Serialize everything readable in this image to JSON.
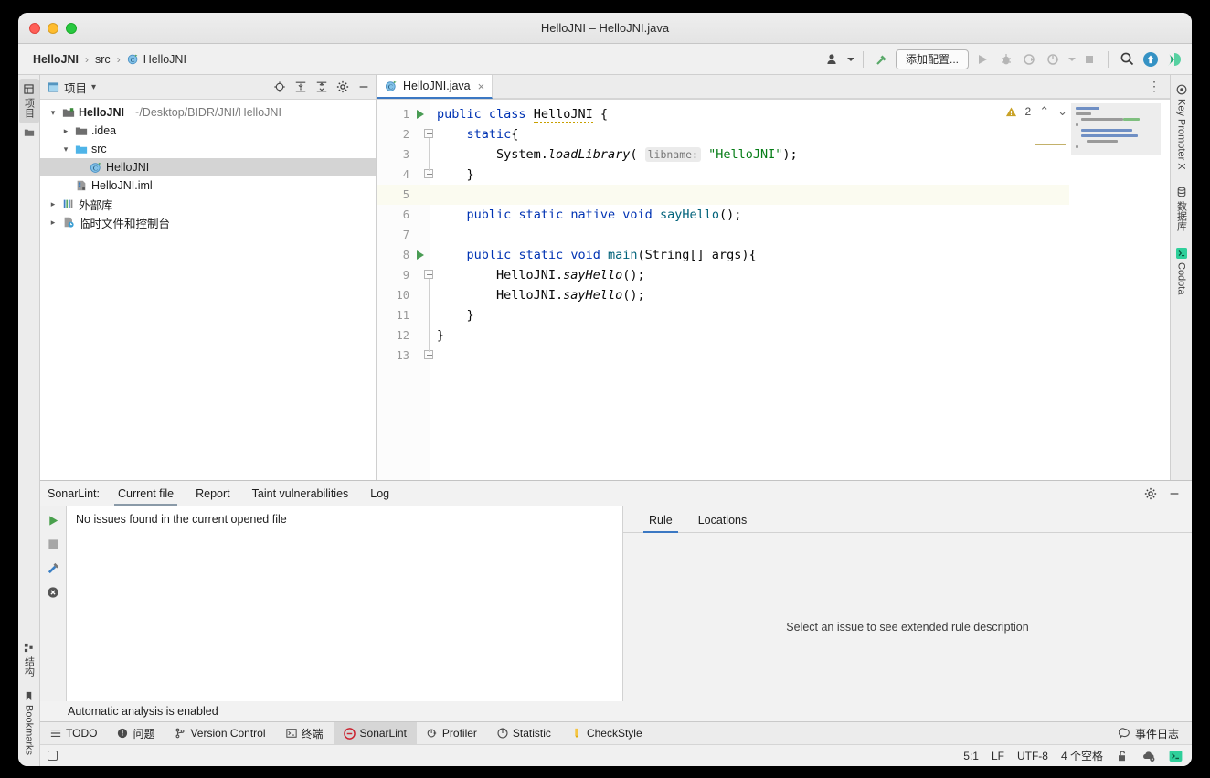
{
  "window": {
    "title": "HelloJNI – HelloJNI.java",
    "traffic": [
      "close",
      "minimize",
      "zoom"
    ]
  },
  "navbar": {
    "breadcrumb": [
      {
        "label": "HelloJNI",
        "icon": "none",
        "bold": true
      },
      {
        "label": "src",
        "icon": "none",
        "bold": false
      },
      {
        "label": "HelloJNI",
        "icon": "java-class-icon",
        "bold": false
      }
    ],
    "separator": "›",
    "config_button": "添加配置...",
    "actions": [
      {
        "name": "user-profile",
        "icon": "person-icon"
      },
      {
        "name": "build-hammer",
        "icon": "hammer-icon"
      },
      {
        "name": "run",
        "icon": "play-icon"
      },
      {
        "name": "debug",
        "icon": "bug-icon"
      },
      {
        "name": "run-with-coverage",
        "icon": "coverage-icon"
      },
      {
        "name": "profile",
        "icon": "profiler-icon"
      },
      {
        "name": "stop",
        "icon": "stop-icon"
      },
      {
        "name": "search-everywhere",
        "icon": "search-icon"
      },
      {
        "name": "update-project",
        "icon": "update-icon"
      },
      {
        "name": "codota",
        "icon": "codota-icon"
      }
    ]
  },
  "left_strip": {
    "top": [
      {
        "label": "项目",
        "icon": "project-icon",
        "active": true
      }
    ],
    "bottom": [
      {
        "label": "结构",
        "icon": "structure-icon",
        "active": false
      },
      {
        "label": "Bookmarks",
        "icon": "bookmark-icon",
        "active": false
      }
    ]
  },
  "right_strip": {
    "items": [
      {
        "label": "Key Promoter X",
        "icon": "key-promoter-icon"
      },
      {
        "label": "数据库",
        "icon": "database-icon"
      },
      {
        "label": "Codota",
        "icon": "codota-icon"
      }
    ]
  },
  "project_panel": {
    "title": "项目",
    "dropdown_caret": "▾",
    "actions": [
      {
        "name": "select-opened-file",
        "icon": "locate-icon"
      },
      {
        "name": "expand-all",
        "icon": "expand-all-icon"
      },
      {
        "name": "collapse-all",
        "icon": "collapse-all-icon"
      },
      {
        "name": "settings",
        "icon": "gear-icon"
      },
      {
        "name": "hide",
        "icon": "minimize-icon"
      }
    ],
    "tree": [
      {
        "label": "HelloJNI",
        "path": "~/Desktop/BIDR/JNI/HelloJNI",
        "icon": "module-icon",
        "arrow": "expanded",
        "depth": 0,
        "bold": true,
        "selected": false
      },
      {
        "label": ".idea",
        "path": "",
        "icon": "folder-icon",
        "arrow": "collapsed",
        "depth": 1,
        "bold": false,
        "selected": false
      },
      {
        "label": "src",
        "path": "",
        "icon": "source-folder-icon",
        "arrow": "expanded",
        "depth": 1,
        "bold": false,
        "selected": false
      },
      {
        "label": "HelloJNI",
        "path": "",
        "icon": "java-class-icon",
        "arrow": "none",
        "depth": 2,
        "bold": false,
        "selected": true
      },
      {
        "label": "HelloJNI.iml",
        "path": "",
        "icon": "iml-file-icon",
        "arrow": "none",
        "depth": 1,
        "bold": false,
        "selected": false
      },
      {
        "label": "外部库",
        "path": "",
        "icon": "library-icon",
        "arrow": "collapsed",
        "depth": 0,
        "bold": false,
        "selected": false
      },
      {
        "label": "临时文件和控制台",
        "path": "",
        "icon": "scratches-icon",
        "arrow": "collapsed",
        "depth": 0,
        "bold": false,
        "selected": false
      }
    ]
  },
  "editor": {
    "tab": {
      "label": "HelloJNI.java",
      "icon": "java-class-icon",
      "close": "×"
    },
    "more_icon": "⋮",
    "inspections": {
      "icon": "warning-triangle-icon",
      "count": "2",
      "prev": "˄",
      "next": "˅"
    },
    "caret_line": 5,
    "lines": [
      {
        "n": "1",
        "marker": "run",
        "fold": "none",
        "highlight": false
      },
      {
        "n": "2",
        "marker": "none",
        "fold": "open",
        "highlight": false
      },
      {
        "n": "3",
        "marker": "none",
        "fold": "none",
        "highlight": false
      },
      {
        "n": "4",
        "marker": "none",
        "fold": "close",
        "highlight": false
      },
      {
        "n": "5",
        "marker": "none",
        "fold": "none",
        "highlight": true
      },
      {
        "n": "6",
        "marker": "none",
        "fold": "none",
        "highlight": false
      },
      {
        "n": "7",
        "marker": "none",
        "fold": "none",
        "highlight": false
      },
      {
        "n": "8",
        "marker": "run",
        "fold": "open",
        "highlight": false
      },
      {
        "n": "9",
        "marker": "none",
        "fold": "none",
        "highlight": false
      },
      {
        "n": "10",
        "marker": "none",
        "fold": "none",
        "highlight": false
      },
      {
        "n": "11",
        "marker": "none",
        "fold": "close",
        "highlight": false
      },
      {
        "n": "12",
        "marker": "none",
        "fold": "none",
        "highlight": false
      },
      {
        "n": "13",
        "marker": "none",
        "fold": "none",
        "highlight": false
      }
    ],
    "code_text": [
      "public class HelloJNI {",
      "    static{",
      "        System.loadLibrary( libname: \"HelloJNI\");",
      "    }",
      "",
      "    public static native void sayHello();",
      "",
      "    public static void main(String[] args){",
      "        HelloJNI.sayHello();",
      "        HelloJNI.sayHello();",
      "    }",
      "}",
      ""
    ]
  },
  "sonarlint": {
    "label": "SonarLint:",
    "tabs": [
      {
        "label": "Current file",
        "active": true
      },
      {
        "label": "Report",
        "active": false
      },
      {
        "label": "Taint vulnerabilities",
        "active": false
      },
      {
        "label": "Log",
        "active": false
      }
    ],
    "header_actions": [
      {
        "name": "settings",
        "icon": "gear-icon"
      },
      {
        "name": "hide",
        "icon": "minimize-icon"
      }
    ],
    "side_icons": [
      {
        "name": "analyze-run",
        "icon": "play-icon"
      },
      {
        "name": "stop-analysis",
        "icon": "stop-icon"
      },
      {
        "name": "configure",
        "icon": "tools-icon"
      },
      {
        "name": "clear",
        "icon": "cancel-circle-icon"
      }
    ],
    "message": "No issues found in the current opened file",
    "status": "Automatic analysis is enabled",
    "rule_tabs": [
      {
        "label": "Rule",
        "active": true
      },
      {
        "label": "Locations",
        "active": false
      }
    ],
    "rule_placeholder": "Select an issue to see extended rule description"
  },
  "bottom_bar": {
    "items": [
      {
        "label": "TODO",
        "icon": "todo-icon",
        "active": false
      },
      {
        "label": "问题",
        "icon": "problems-icon",
        "active": false
      },
      {
        "label": "Version Control",
        "icon": "branch-icon",
        "active": false
      },
      {
        "label": "终端",
        "icon": "terminal-icon",
        "active": false
      },
      {
        "label": "SonarLint",
        "icon": "sonarlint-icon",
        "active": true
      },
      {
        "label": "Profiler",
        "icon": "profiler-icon",
        "active": false
      },
      {
        "label": "Statistic",
        "icon": "statistic-icon",
        "active": false
      },
      {
        "label": "CheckStyle",
        "icon": "checkstyle-icon",
        "active": false
      }
    ],
    "right": {
      "label": "事件日志",
      "icon": "event-log-icon"
    }
  },
  "status_bar": {
    "left_icon": "memory-indicator-icon",
    "right": [
      {
        "name": "caret-position",
        "label": "5:1"
      },
      {
        "name": "line-separator",
        "label": "LF"
      },
      {
        "name": "file-encoding",
        "label": "UTF-8"
      },
      {
        "name": "indent",
        "label": "4 个空格"
      },
      {
        "name": "read-only-toggle",
        "label": "",
        "icon": "lock-open-icon"
      },
      {
        "name": "cloud-settings",
        "label": "",
        "icon": "cloud-gear-icon"
      },
      {
        "name": "terminal-toggle",
        "label": "",
        "icon": "terminal-green-icon"
      }
    ]
  },
  "colors": {
    "accent_blue": "#3b78c3",
    "keyword": "#0033b3",
    "string": "#067d17",
    "method": "#00627a",
    "green_run": "#499c54",
    "warning": "#c8a000",
    "sonar_red": "#cb2431"
  }
}
